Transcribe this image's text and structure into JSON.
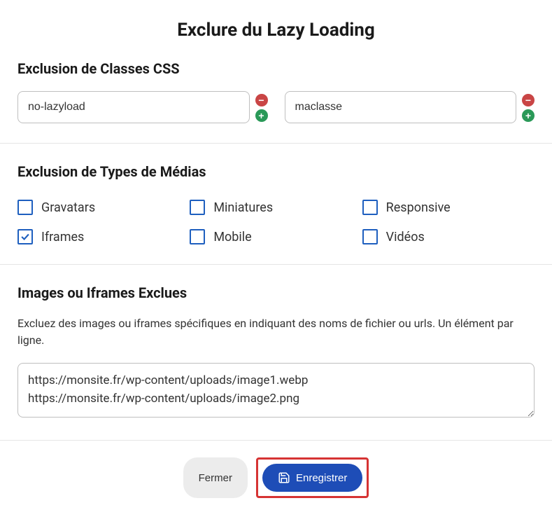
{
  "modalTitle": "Exclure du Lazy Loading",
  "cssSection": {
    "title": "Exclusion de Classes CSS",
    "inputs": [
      {
        "value": "no-lazyload"
      },
      {
        "value": "maclasse"
      }
    ]
  },
  "mediaSection": {
    "title": "Exclusion de Types de Médias",
    "options": [
      {
        "label": "Gravatars",
        "checked": false
      },
      {
        "label": "Miniatures",
        "checked": false
      },
      {
        "label": "Responsive",
        "checked": false
      },
      {
        "label": "Iframes",
        "checked": true
      },
      {
        "label": "Mobile",
        "checked": false
      },
      {
        "label": "Vidéos",
        "checked": false
      }
    ]
  },
  "imagesSection": {
    "title": "Images ou Iframes Exclues",
    "description": "Excluez des images ou iframes spécifiques en indiquant des noms de fichier ou urls. Un élément par ligne.",
    "textarea": "https://monsite.fr/wp-content/uploads/image1.webp\nhttps://monsite.fr/wp-content/uploads/image2.png"
  },
  "footer": {
    "close": "Fermer",
    "save": "Enregistrer"
  }
}
